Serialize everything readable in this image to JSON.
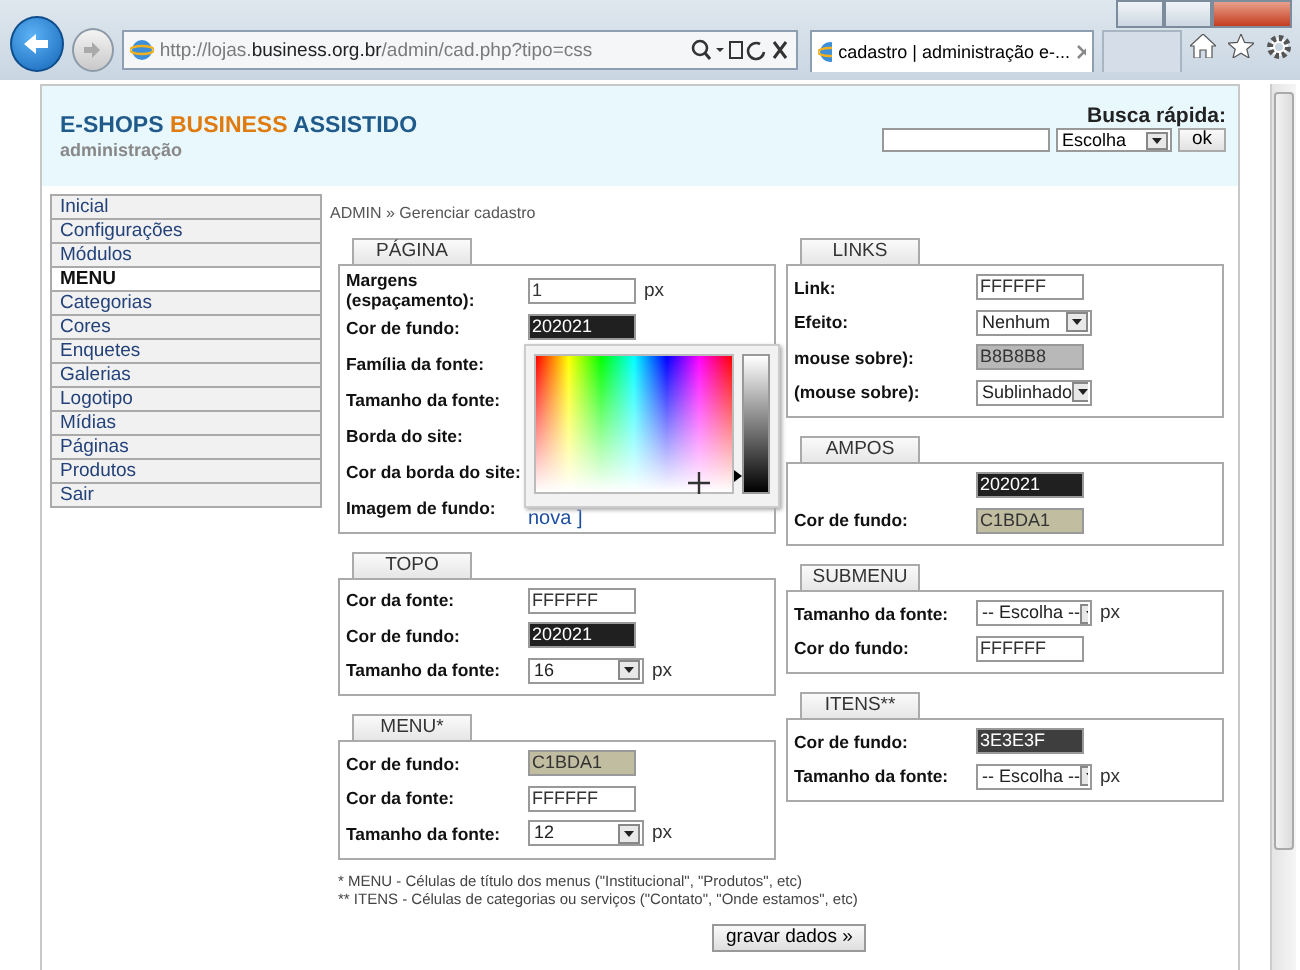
{
  "browser": {
    "url_prefix": "http://lojas.",
    "url_domain": "business.org.br",
    "url_path": "/admin/cad.php?tipo=css",
    "tab_title": "cadastro | administração e-..."
  },
  "header": {
    "logo": [
      {
        "text": "E-SHOPS",
        "color": "#1f5a8a"
      },
      {
        "text": "BUSINESS",
        "color": "#e07b10"
      },
      {
        "text": "ASSISTIDO",
        "color": "#1f5a8a"
      }
    ],
    "subtitle": "administração",
    "search": {
      "label": "Busca rápida:",
      "select": "Escolha",
      "button": "ok"
    }
  },
  "sidebar": {
    "items": [
      {
        "label": "Inicial",
        "selected": false
      },
      {
        "label": "Configurações",
        "selected": false
      },
      {
        "label": "Módulos",
        "selected": false
      },
      {
        "label": "MENU",
        "selected": true
      },
      {
        "label": "Categorias",
        "selected": false
      },
      {
        "label": "Cores",
        "selected": false
      },
      {
        "label": "Enquetes",
        "selected": false
      },
      {
        "label": "Galerias",
        "selected": false
      },
      {
        "label": "Logotipo",
        "selected": false
      },
      {
        "label": "Mídias",
        "selected": false
      },
      {
        "label": "Páginas",
        "selected": false
      },
      {
        "label": "Produtos",
        "selected": false
      },
      {
        "label": "Sair",
        "selected": false
      }
    ]
  },
  "breadcrumb": "ADMIN » Gerenciar cadastro",
  "columns": [
    [
      {
        "title": "PÁGINA",
        "rows": [
          {
            "label": "Margens (espaçamento):",
            "kind": "text",
            "value": "1",
            "unit": "px"
          },
          {
            "label": "Cor de fundo:",
            "kind": "color",
            "value": "202021",
            "color": "#202021"
          },
          {
            "label": "Família da fonte:",
            "kind": "label"
          },
          {
            "label": "Tamanho da fonte:",
            "kind": "label"
          },
          {
            "label": "Borda do site:",
            "kind": "label"
          },
          {
            "label": "Cor da borda do site:",
            "kind": "label"
          },
          {
            "label": "Imagem de fundo:",
            "kind": "link",
            "value": "nova ]"
          }
        ]
      },
      {
        "title": "TOPO",
        "rows": [
          {
            "label": "Cor da fonte:",
            "kind": "text",
            "value": "FFFFFF"
          },
          {
            "label": "Cor de fundo:",
            "kind": "color",
            "value": "202021",
            "color": "#202021"
          },
          {
            "label": "Tamanho da fonte:",
            "kind": "select",
            "value": "16",
            "unit": "px"
          }
        ]
      },
      {
        "title": "MENU*",
        "rows": [
          {
            "label": "Cor de fundo:",
            "kind": "color",
            "value": "C1BDA1",
            "color": "#c1bda1"
          },
          {
            "label": "Cor da fonte:",
            "kind": "text",
            "value": "FFFFFF"
          },
          {
            "label": "Tamanho da fonte:",
            "kind": "select",
            "value": "12",
            "unit": "px"
          }
        ]
      }
    ],
    [
      {
        "title": "LINKS",
        "rows": [
          {
            "label": "Link:",
            "kind": "text",
            "value": "FFFFFF"
          },
          {
            "label": "Efeito:",
            "kind": "select",
            "value": "Nenhum"
          },
          {
            "label": "mouse sobre):",
            "kind": "color",
            "value": "B8B8B8",
            "color": "#b8b8b8"
          },
          {
            "label": "(mouse sobre):",
            "kind": "select",
            "value": "Sublinhado"
          }
        ]
      },
      {
        "title": "AMPOS",
        "rows": [
          {
            "kind": "color",
            "value": "202021",
            "color": "#202021"
          },
          {
            "label": "Cor de fundo:",
            "kind": "color",
            "value": "C1BDA1",
            "color": "#c1bda1"
          }
        ]
      },
      {
        "title": "SUBMENU",
        "rows": [
          {
            "label": "Tamanho da fonte:",
            "kind": "select",
            "value": "-- Escolha --",
            "unit": "px"
          },
          {
            "label": "Cor do fundo:",
            "kind": "text",
            "value": "FFFFFF"
          }
        ]
      },
      {
        "title": "ITENS**",
        "rows": [
          {
            "label": "Cor de fundo:",
            "kind": "color",
            "value": "3E3E3F",
            "color": "#3e3e3f"
          },
          {
            "label": "Tamanho da fonte:",
            "kind": "select",
            "value": "-- Escolha --",
            "unit": "px"
          }
        ]
      }
    ]
  ],
  "color_picker": {
    "level": 0.12
  },
  "notes": [
    "* MENU - Células de título dos menus (\"Institucional\", \"Produtos\", etc)",
    "** ITENS - Células de categorias ou serviços (\"Contato\", \"Onde estamos\", etc)"
  ],
  "submit": "gravar dados »"
}
